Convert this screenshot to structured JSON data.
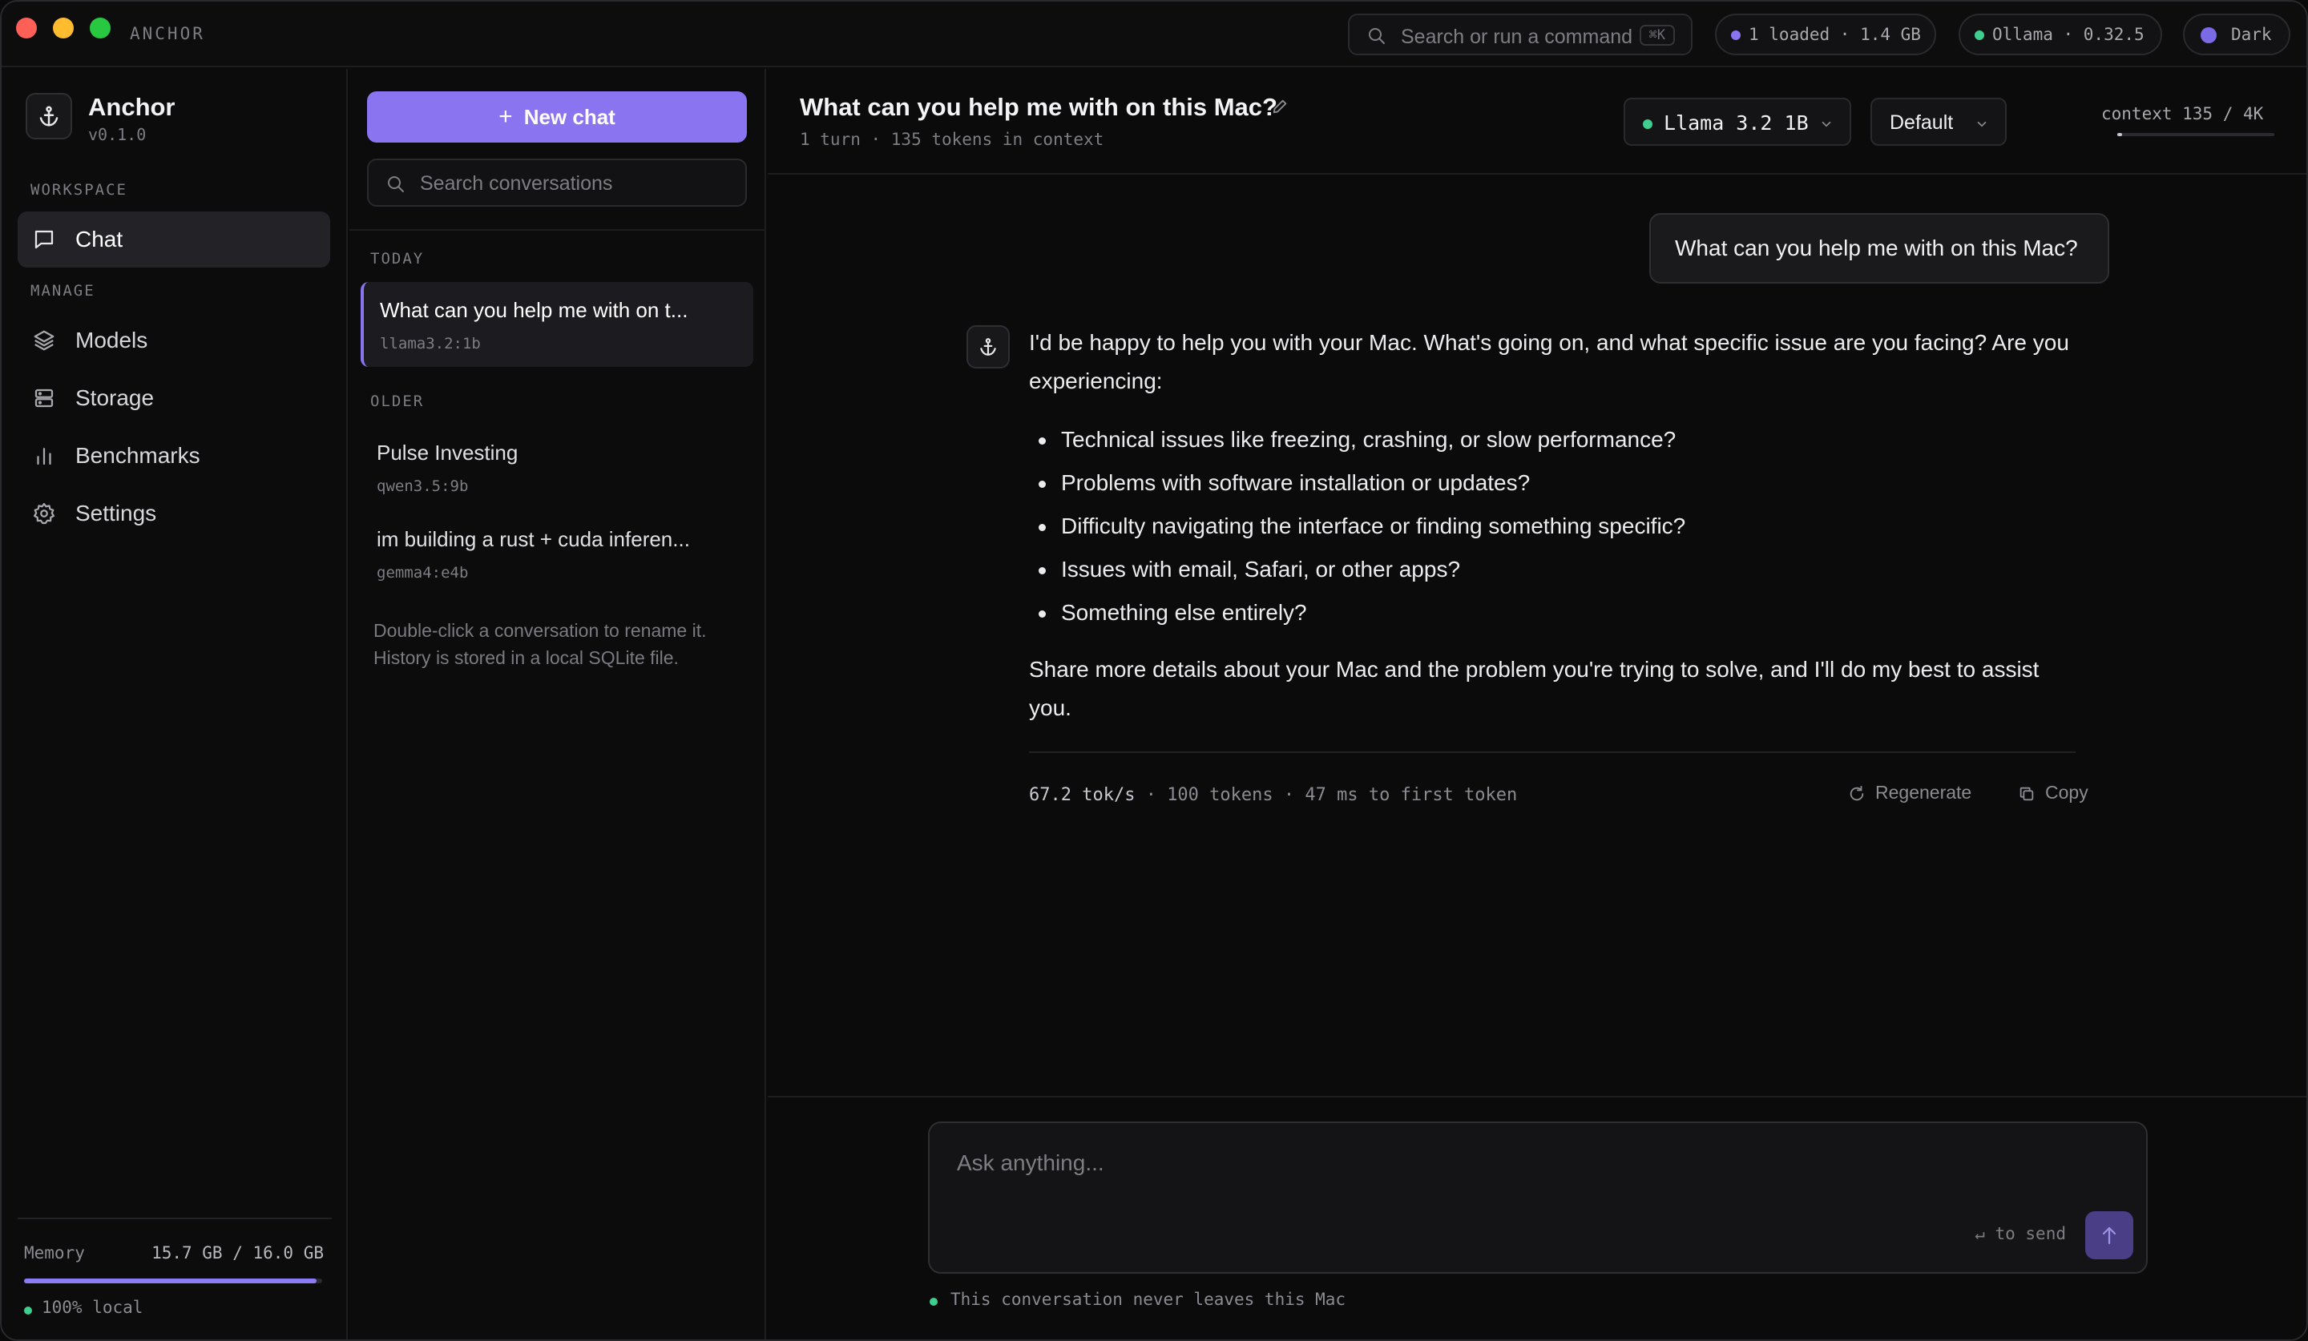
{
  "app": {
    "name": "ANCHOR",
    "brand": "Anchor",
    "version": "v0.1.0"
  },
  "titlebar": {
    "search_placeholder": "Search or run a command",
    "search_shortcut": "⌘K",
    "loaded_status": "1 loaded · 1.4 GB",
    "ollama_status": "Ollama · 0.32.5",
    "theme_label": "Dark"
  },
  "sidebar": {
    "workspace_label": "WORKSPACE",
    "manage_label": "MANAGE",
    "items": [
      {
        "label": "Chat",
        "icon": "chat-icon"
      },
      {
        "label": "Models",
        "icon": "layers-icon"
      },
      {
        "label": "Storage",
        "icon": "storage-icon"
      },
      {
        "label": "Benchmarks",
        "icon": "bar-chart-icon"
      },
      {
        "label": "Settings",
        "icon": "gear-icon"
      }
    ],
    "memory_label": "Memory",
    "memory_value": "15.7 GB / 16.0 GB",
    "memory_fraction": 0.98,
    "local_label": "100% local"
  },
  "conversations": {
    "new_chat_label": "New chat",
    "search_placeholder": "Search conversations",
    "today_label": "TODAY",
    "older_label": "OLDER",
    "today": [
      {
        "title": "What can you help me with on t...",
        "model": "llama3.2:1b"
      }
    ],
    "older": [
      {
        "title": "Pulse Investing",
        "model": "qwen3.5:9b"
      },
      {
        "title": "im building a rust + cuda inferen...",
        "model": "gemma4:e4b"
      }
    ],
    "hint": "Double-click a conversation to rename it. History is stored in a local SQLite file."
  },
  "chat": {
    "title": "What can you help me with on this Mac?",
    "meta": "1 turn · 135 tokens in context",
    "model_label": "Llama 3.2 1B",
    "preset_label": "Default",
    "context_label": "context 135 / 4K",
    "context_fraction": 0.033,
    "user_message": "What can you help me with on this Mac?",
    "assistant_intro": "I'd be happy to help you with your Mac. What's going on, and what specific issue are you facing? Are you experiencing:",
    "assistant_bullets": [
      "Technical issues like freezing, crashing, or slow performance?",
      "Problems with software installation or updates?",
      "Difficulty navigating the interface or finding something specific?",
      "Issues with email, Safari, or other apps?",
      "Something else entirely?"
    ],
    "assistant_outro": "Share more details about your Mac and the problem you're trying to solve, and I'll do my best to assist you.",
    "stats_tps": "67.2 tok/s",
    "stats_rest": " · 100 tokens · 47 ms to first token",
    "regenerate_label": "Regenerate",
    "copy_label": "Copy"
  },
  "composer": {
    "placeholder": "Ask anything...",
    "send_hint": "↵ to send",
    "privacy_note": "This conversation never leaves this Mac"
  },
  "colors": {
    "accent": "#8b74f0",
    "status_green": "#3ecf8e",
    "background": "#0b0b0c"
  }
}
